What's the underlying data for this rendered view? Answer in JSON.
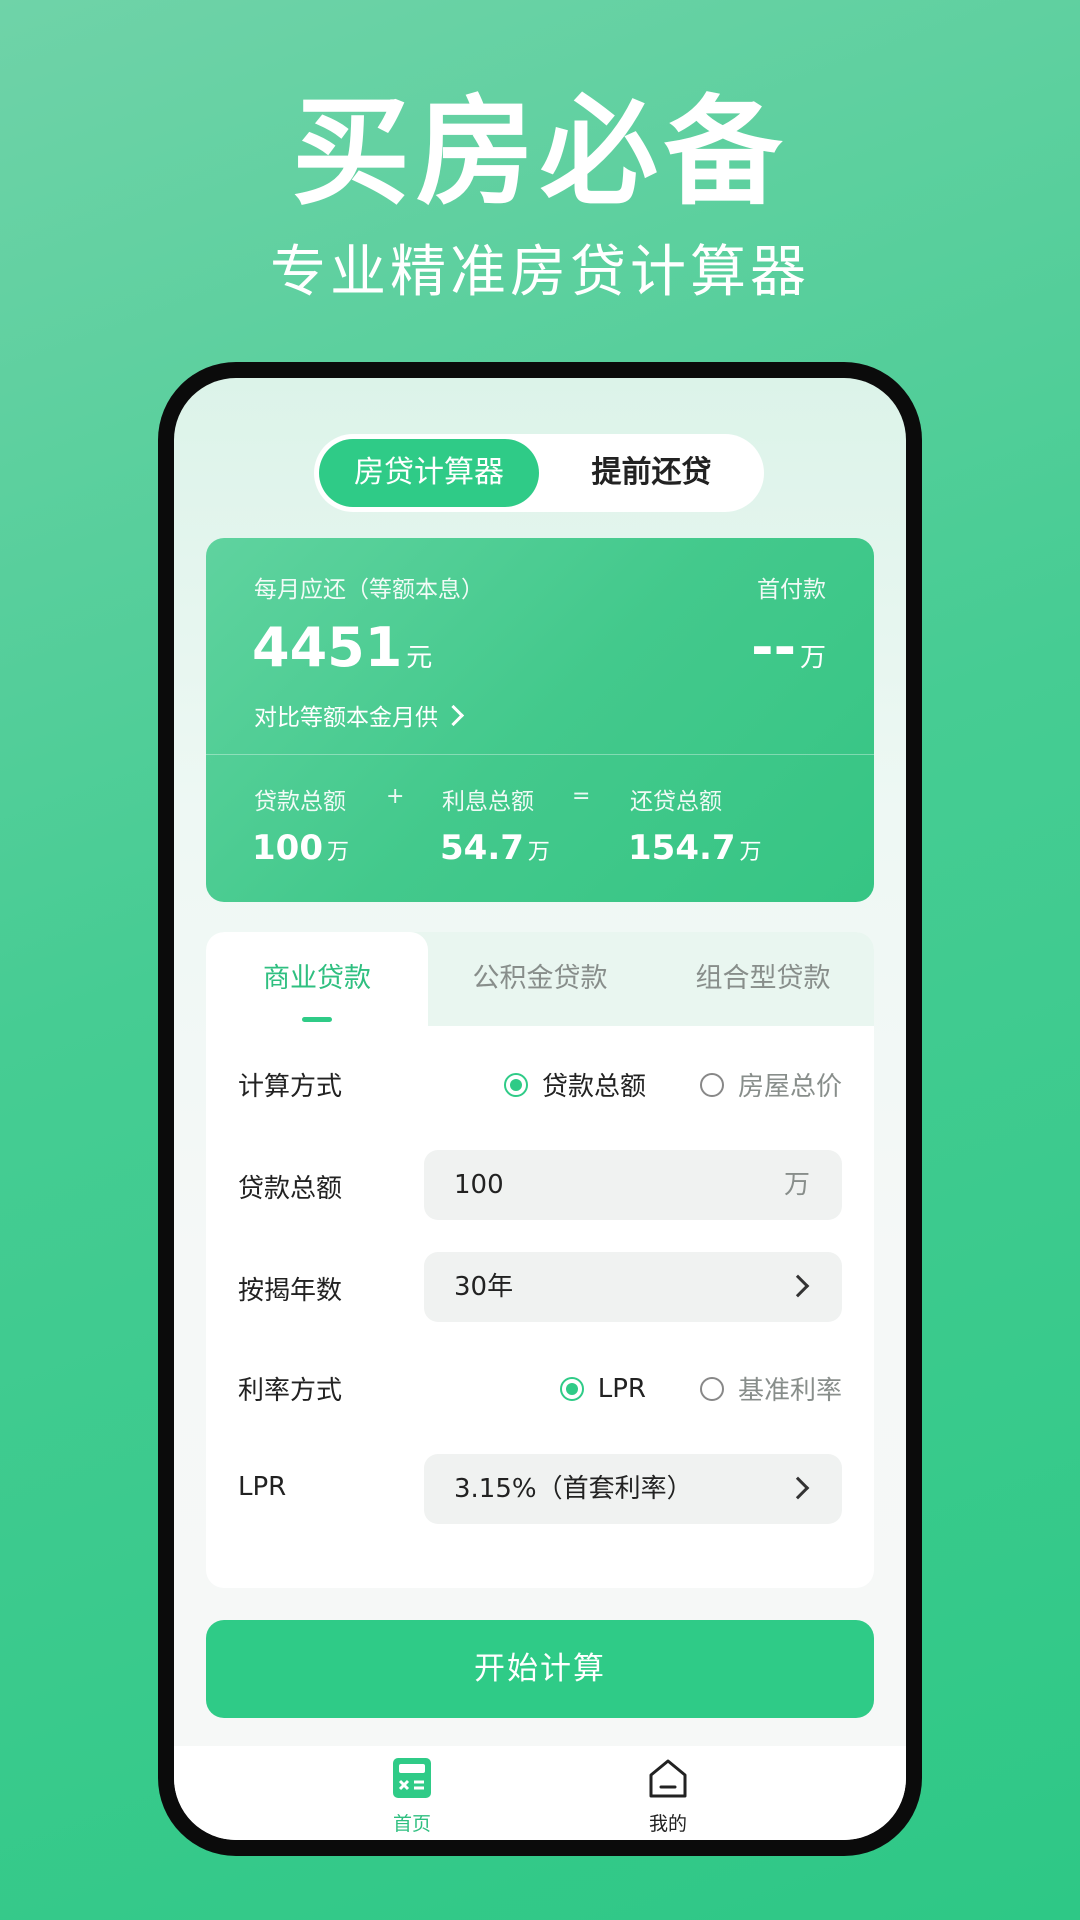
{
  "hero": {
    "title": "买房必备",
    "subtitle": "专业精准房贷计算器"
  },
  "top_tabs": {
    "active": "房贷计算器",
    "inactive": "提前还贷"
  },
  "result": {
    "monthly_label": "每月应还（等额本息）",
    "monthly_value": "4451",
    "monthly_unit": "元",
    "down_label": "首付款",
    "down_value": "--",
    "down_unit": "万",
    "compare_link": "对比等额本金月供",
    "loan_total_label": "贷款总额",
    "plus": "+",
    "interest_total_label": "利息总额",
    "equals": "=",
    "repay_total_label": "还贷总额",
    "loan_total_value": "100",
    "interest_total_value": "54.7",
    "repay_total_value": "154.7",
    "wan_unit": "万"
  },
  "loan_tabs": [
    "商业贷款",
    "公积金贷款",
    "组合型贷款"
  ],
  "form": {
    "calc_method_label": "计算方式",
    "calc_opt_1": "贷款总额",
    "calc_opt_2": "房屋总价",
    "loan_amount_label": "贷款总额",
    "loan_amount_value": "100",
    "loan_amount_unit": "万",
    "years_label": "按揭年数",
    "years_value": "30年",
    "rate_method_label": "利率方式",
    "rate_opt_1": "LPR",
    "rate_opt_2": "基准利率",
    "lpr_label": "LPR",
    "lpr_value": "3.15%（首套利率）"
  },
  "start_button": "开始计算",
  "nav": {
    "home": "首页",
    "mine": "我的"
  },
  "colors": {
    "accent": "#2fcb87",
    "accent_text": "#2fbf80"
  }
}
